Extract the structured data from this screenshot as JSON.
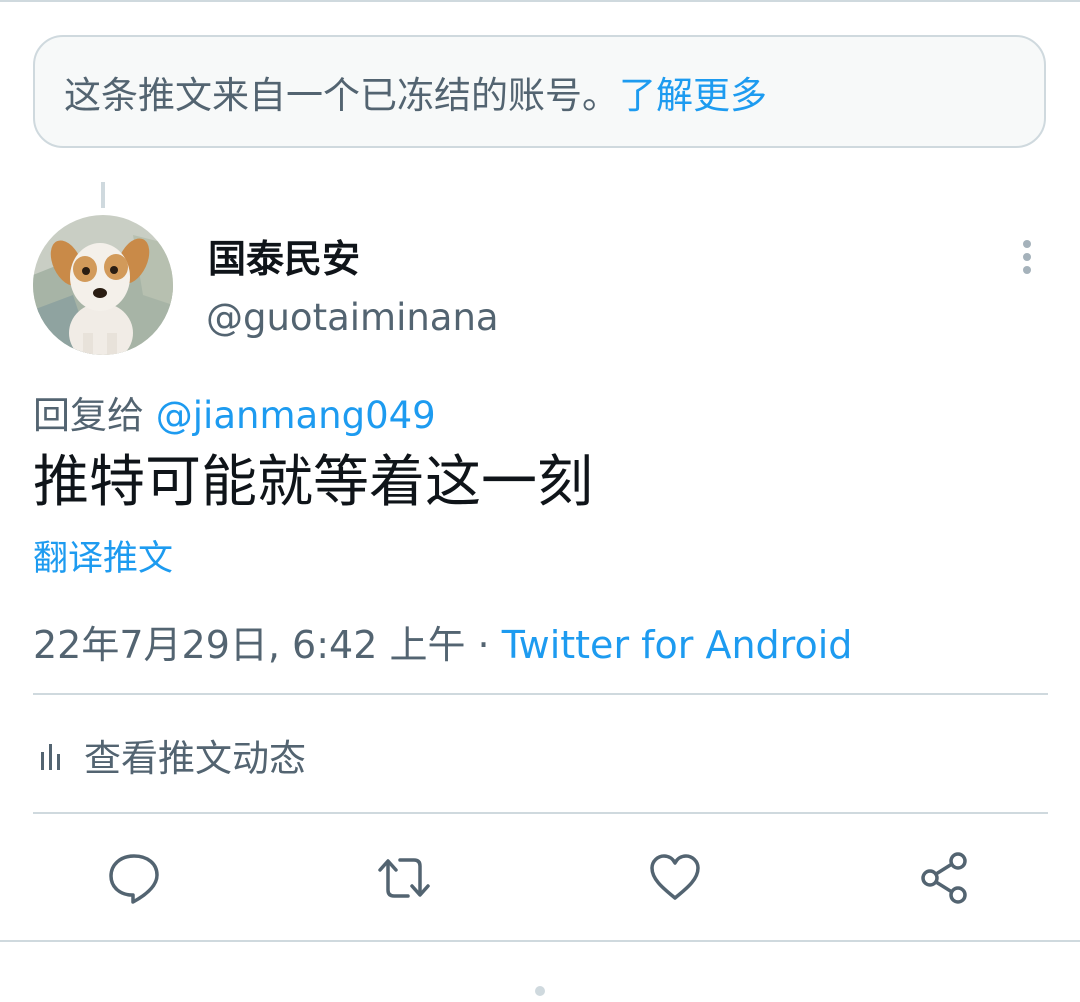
{
  "notice": {
    "text": "这条推文来自一个已冻结的账号。",
    "learn_more": "了解更多"
  },
  "author": {
    "display_name": "国泰民安",
    "handle": "@guotaiminana",
    "avatar_icon": "dog-avatar"
  },
  "tweet": {
    "reply_prefix": "回复给 ",
    "reply_to": "@jianmang049",
    "text": "推特可能就等着这一刻",
    "translate_label": "翻译推文",
    "timestamp": "22年7月29日, 6:42 上午 · ",
    "source": "Twitter for Android"
  },
  "activity": {
    "label": "查看推文动态",
    "icon": "bar-chart-icon"
  },
  "actions": [
    {
      "icon": "reply-icon"
    },
    {
      "icon": "retweet-icon"
    },
    {
      "icon": "like-icon"
    },
    {
      "icon": "share-icon"
    }
  ],
  "colors": {
    "accent": "#1d9bf0",
    "text_primary": "#0f1419",
    "text_secondary": "#536471",
    "border": "#cfd9de"
  }
}
